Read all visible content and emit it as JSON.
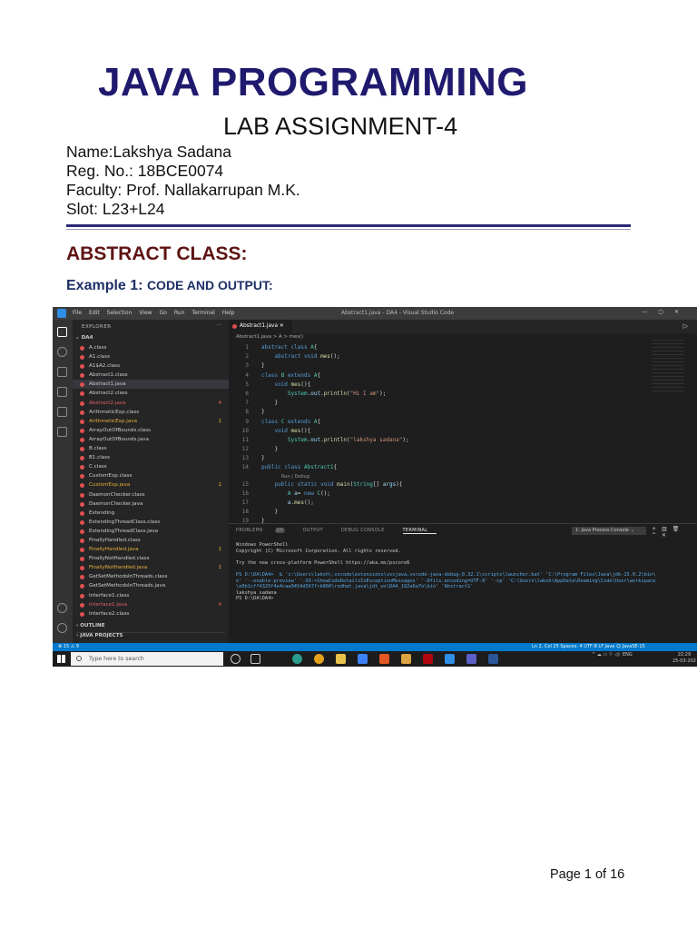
{
  "document": {
    "title": "JAVA PROGRAMMING",
    "subtitle": "LAB ASSIGNMENT-4",
    "meta": [
      "Name:Lakshya Sadana",
      "Reg. No.: 18BCE0074",
      "Faculty: Prof. Nallakarrupan M.K.",
      "Slot: L23+L24"
    ],
    "section_heading": "ABSTRACT CLASS:",
    "example_label": "Example 1:",
    "example_sub": "CODE AND OUTPUT:",
    "footer": "Page 1 of 16"
  },
  "vscode": {
    "menu": [
      "File",
      "Edit",
      "Selection",
      "View",
      "Go",
      "Run",
      "Terminal",
      "Help"
    ],
    "window_title": "Abstract1.java - DA4 - Visual Studio Code",
    "explorer_label": "EXPLORER",
    "explorer_more": "···",
    "folder": "DA4",
    "files": [
      {
        "name": "A.class",
        "state": "normal"
      },
      {
        "name": "A1.class",
        "state": "normal"
      },
      {
        "name": "A1$A2.class",
        "state": "normal"
      },
      {
        "name": "Abstract1.class",
        "state": "normal"
      },
      {
        "name": "Abstract1.java",
        "state": "selected"
      },
      {
        "name": "Abstract2.class",
        "state": "normal"
      },
      {
        "name": "Abstract2.java",
        "state": "err",
        "count": "4"
      },
      {
        "name": "ArithmeticExp.class",
        "state": "normal"
      },
      {
        "name": "ArithmeticExp.java",
        "state": "warn",
        "count": "1"
      },
      {
        "name": "ArrayOutOfBounds.class",
        "state": "normal"
      },
      {
        "name": "ArrayOutOfBounds.java",
        "state": "normal"
      },
      {
        "name": "B.class",
        "state": "normal"
      },
      {
        "name": "B1.class",
        "state": "normal"
      },
      {
        "name": "C.class",
        "state": "normal"
      },
      {
        "name": "CustomExp.class",
        "state": "normal"
      },
      {
        "name": "CustomExp.java",
        "state": "warn",
        "count": "1"
      },
      {
        "name": "DaemonChecker.class",
        "state": "normal"
      },
      {
        "name": "DaemonChecker.java",
        "state": "normal"
      },
      {
        "name": "Extending",
        "state": "normal"
      },
      {
        "name": "ExtendingThreadClass.class",
        "state": "normal"
      },
      {
        "name": "ExtendingThreadClass.java",
        "state": "normal"
      },
      {
        "name": "FinallyHandled.class",
        "state": "normal"
      },
      {
        "name": "FinallyHandled.java",
        "state": "warn",
        "count": "1"
      },
      {
        "name": "FinallyNotHandled.class",
        "state": "normal"
      },
      {
        "name": "FinallyNotHandled.java",
        "state": "warn",
        "count": "1"
      },
      {
        "name": "GetSetMethodsInThreads.class",
        "state": "normal"
      },
      {
        "name": "GetSetMethodsInThreads.java",
        "state": "normal"
      },
      {
        "name": "Interface1.class",
        "state": "normal"
      },
      {
        "name": "Interface1.java",
        "state": "err",
        "count": "4"
      },
      {
        "name": "Interface2.class",
        "state": "normal"
      }
    ],
    "outline_label": "OUTLINE",
    "java_projects_label": "JAVA PROJECTS",
    "tab_label": "Abstract1.java",
    "breadcrumb": "Abstract1.java > A > mes()",
    "code": [
      {
        "n": "1",
        "t": "abstract class A{"
      },
      {
        "n": "2",
        "t": "    abstract void mes();"
      },
      {
        "n": "3",
        "t": "}"
      },
      {
        "n": "4",
        "t": "class B extends A{"
      },
      {
        "n": "5",
        "t": "    void mes(){"
      },
      {
        "n": "6",
        "t": "        System.out.println(\"Hi I am\");"
      },
      {
        "n": "7",
        "t": "    }"
      },
      {
        "n": "8",
        "t": "}"
      },
      {
        "n": "9",
        "t": "class C extends A{"
      },
      {
        "n": "10",
        "t": "    void mes(){"
      },
      {
        "n": "11",
        "t": "        System.out.println(\"lakshya sadana\");"
      },
      {
        "n": "12",
        "t": "    }"
      },
      {
        "n": "13",
        "t": "}"
      },
      {
        "n": "14",
        "t": "public class Abstract1{"
      },
      {
        "n": "",
        "t": "Run | Debug",
        "lens": true
      },
      {
        "n": "15",
        "t": "    public static void main(String[] args){"
      },
      {
        "n": "16",
        "t": "        A a= new C();"
      },
      {
        "n": "17",
        "t": "        a.mes();"
      },
      {
        "n": "18",
        "t": "    }"
      },
      {
        "n": "19",
        "t": "}"
      }
    ],
    "panel_tabs": [
      {
        "label": "PROBLEMS",
        "badge": "24"
      },
      {
        "label": "OUTPUT"
      },
      {
        "label": "DEBUG CONSOLE"
      },
      {
        "label": "TERMINAL",
        "active": true
      }
    ],
    "terminal_select": "1: Java Process Console",
    "terminal_lines": [
      "Windows PowerShell",
      "Copyright (C) Microsoft Corporation. All rights reserved.",
      "",
      "Try the new cross-platform PowerShell https://aka.ms/pscore6",
      "",
      "PS D:\\DA\\DA4>  & 'c:\\Users\\laksh\\.vscode\\extensions\\vscjava.vscode-java-debug-0.32.1\\scripts\\launcher.bat' 'C:\\Program Files\\Java\\jdk-15.0.2\\bin\\",
      "e' '--enable-preview' '-XX:+ShowCodeDetailsInExceptionMessages' '-Dfile.encoding=UTF-8' '-cp' 'C:\\Users\\laksh\\AppData\\Roaming\\Code\\User\\workspace",
      "\\e0b1cff4325f4e4caa0454d567fcb060\\redhat.java\\jdt_ws\\DA4_192a6a7e\\bin' 'Abstract1'",
      "lakshya sadana",
      "PS D:\\DA\\DA4>"
    ],
    "status_left": "⊗ 15 ⚠ 9",
    "status_right": "Ln 2, Col 25   Spaces: 4   UTF-8   LF   Java   ☺   JavaSE-15",
    "taskbar_search": "Type here to search",
    "tray_lang": "ENG",
    "clock_time": "22:29",
    "clock_date": "25-03-202"
  }
}
